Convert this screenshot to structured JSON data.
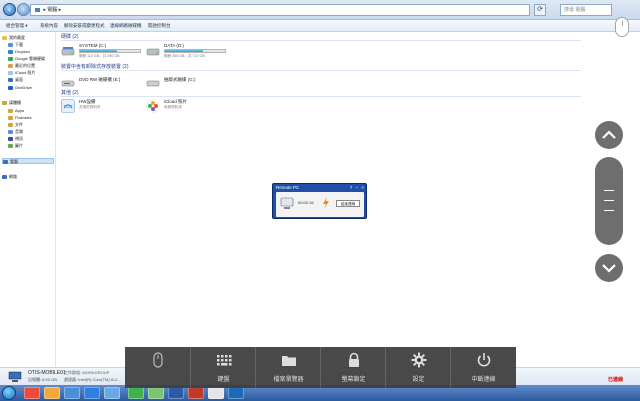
{
  "address": {
    "path": "▸ 電腦 ▸",
    "search_placeholder": "搜尋 電腦"
  },
  "toolbar": {
    "items": [
      "組合管理 ▾",
      "系統內容",
      "解除安裝或變更程式",
      "連線網路磁碟機",
      "開啟控制台"
    ]
  },
  "sidebar": {
    "favorites_header": "我的最愛",
    "items": [
      {
        "label": "下載"
      },
      {
        "label": "Dropbox"
      },
      {
        "label": "Google 雲端硬碟"
      },
      {
        "label": "最近的位置"
      },
      {
        "label": "iCloud 照片"
      },
      {
        "label": "桌面"
      },
      {
        "label": "OneDrive"
      }
    ],
    "library_header": "媒體櫃",
    "library_items": [
      {
        "label": "Apps"
      },
      {
        "label": "Podcasts"
      },
      {
        "label": "文件"
      },
      {
        "label": "音樂"
      },
      {
        "label": "視訊"
      },
      {
        "label": "圖片"
      }
    ],
    "computer": "電腦",
    "network": "網路"
  },
  "main": {
    "groups": [
      {
        "title": "硬碟 (2)"
      },
      {
        "title": "裝置中含有卸除式存放裝置 (2)"
      },
      {
        "title": "其他 (2)"
      }
    ],
    "drives": [
      {
        "name": "SYSTEM (C:)",
        "free": "剩餘 110 GB，共 290 GB",
        "usage": 0.62
      },
      {
        "name": "DATA (D:)",
        "free": "剩餘 265 GB，共 722 GB",
        "usage": 0.63
      }
    ],
    "removable": [
      {
        "name": "DVD RW 磁碟機 (E:)"
      },
      {
        "name": "抽取式磁碟 (G:)"
      }
    ],
    "others": [
      {
        "name": "HW設備",
        "sub": "共用的資料夾"
      },
      {
        "name": "iCloud 照片",
        "sub": "系統資料夾"
      }
    ]
  },
  "popup": {
    "title": "Remote PC",
    "timer": "00:02:16",
    "disconnect_label": "結束連線"
  },
  "details": {
    "computer_name": "OTIS-MOBILE01",
    "workgroup": "工作群組: WORKGROUP",
    "cpu": "處理器: Intel(R) Core(TM) i5-2...",
    "memory": "記憶體: 8.00 GB"
  },
  "overlay": {
    "items": [
      {
        "label": ""
      },
      {
        "label": "鍵盤"
      },
      {
        "label": "檔案瀏覽器"
      },
      {
        "label": "螢幕鎖定"
      },
      {
        "label": "設定"
      },
      {
        "label": "中斷連線"
      }
    ]
  },
  "status": {
    "connected_label": "已連線"
  }
}
